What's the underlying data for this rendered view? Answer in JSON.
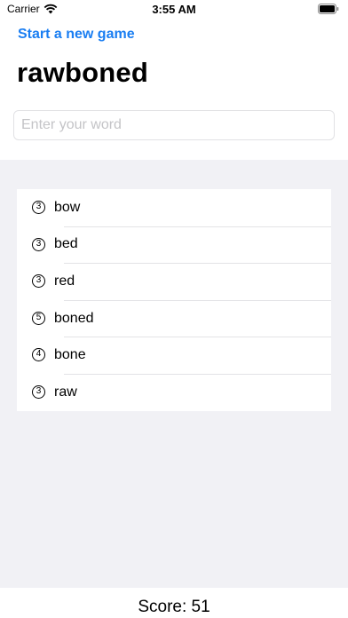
{
  "status_bar": {
    "carrier": "Carrier",
    "time": "3:55 AM"
  },
  "header": {
    "new_game_label": "Start a new game",
    "title": "rawboned"
  },
  "input": {
    "placeholder": "Enter your word",
    "value": ""
  },
  "words": [
    {
      "count": "3",
      "word": "bow"
    },
    {
      "count": "3",
      "word": "bed"
    },
    {
      "count": "3",
      "word": "red"
    },
    {
      "count": "5",
      "word": "boned"
    },
    {
      "count": "4",
      "word": "bone"
    },
    {
      "count": "3",
      "word": "raw"
    }
  ],
  "footer": {
    "score": "Score: 51"
  },
  "colors": {
    "accent": "#1a7ef2",
    "grouped_background": "#f1f1f5"
  }
}
